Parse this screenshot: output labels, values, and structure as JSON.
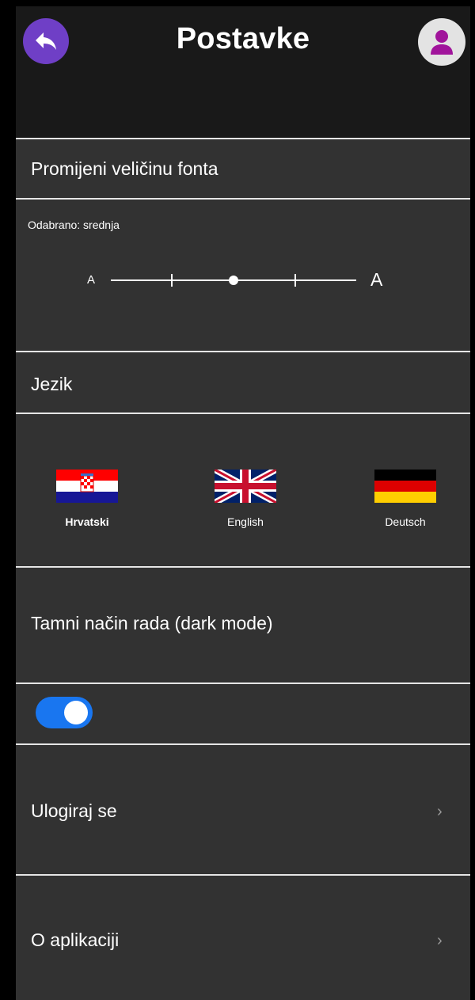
{
  "header": {
    "title": "Postavke",
    "back_icon": "back-arrow-icon",
    "profile_icon": "person-icon"
  },
  "font_size": {
    "label": "Promijeni veličinu fonta",
    "selected_text": "Odabrano: srednja",
    "small_a": "A",
    "large_a": "A",
    "level": 0.5
  },
  "language": {
    "label": "Jezik",
    "options": [
      {
        "name": "Hrvatski",
        "selected": true,
        "flag": "croatia-flag-icon"
      },
      {
        "name": "English",
        "selected": false,
        "flag": "uk-flag-icon"
      },
      {
        "name": "Deutsch",
        "selected": false,
        "flag": "germany-flag-icon"
      }
    ]
  },
  "dark_mode": {
    "label": "Tamni način rada (dark mode)",
    "enabled": true
  },
  "login": {
    "label": "Ulogiraj se"
  },
  "about": {
    "label": "O aplikaciji"
  },
  "colors": {
    "header_bg": "#191919",
    "screen_bg": "#323232",
    "back_button": "#6f3fc6",
    "avatar_icon": "#a0149b",
    "toggle_on": "#1976f0"
  }
}
